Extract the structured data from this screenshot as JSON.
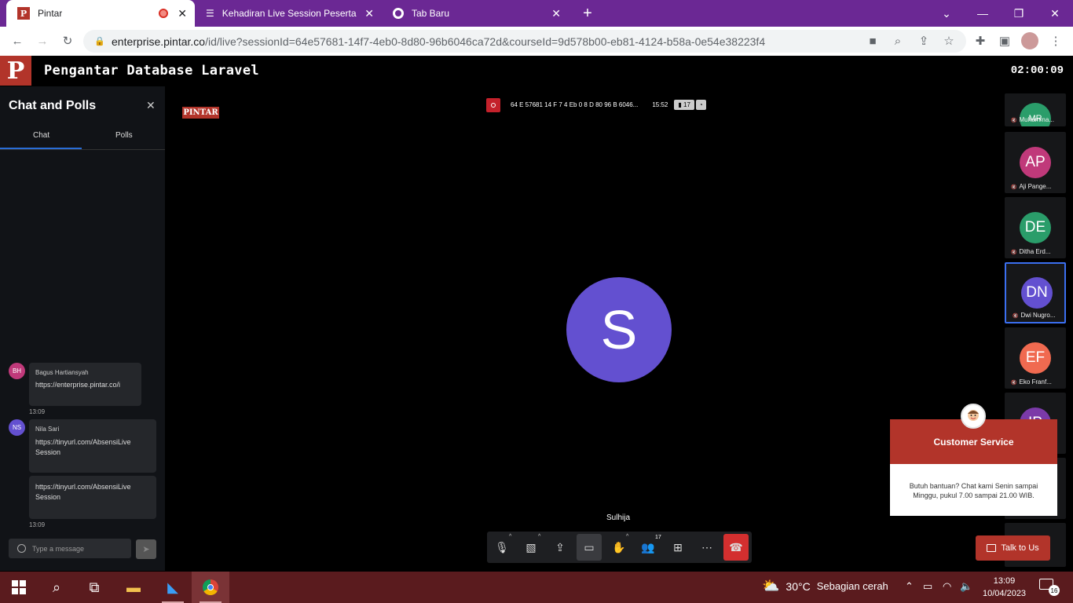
{
  "browser": {
    "tabs": [
      {
        "title": "Pintar",
        "active": true
      },
      {
        "title": "Kehadiran Live Session Peserta D",
        "active": false
      },
      {
        "title": "Tab Baru",
        "active": false
      }
    ],
    "url_domain": "enterprise.pintar.co",
    "url_path": "/id/live?sessionId=64e57681-14f7-4eb0-8d80-96b6046ca72d&courseId=9d578b00-eb81-4124-b58a-0e54e38223f4"
  },
  "header": {
    "logo": "P",
    "course_title": "Pengantar Database Laravel",
    "timer": "02:00:09"
  },
  "chat": {
    "title": "Chat and Polls",
    "tabs": [
      "Chat",
      "Polls"
    ],
    "messages": [
      {
        "initials": "BH",
        "avatar_color": "#c0397a",
        "sender": "Bagus Hartiansyah",
        "text": "https://enterprise.pintar.co/i",
        "time": "13:09"
      },
      {
        "initials": "NS",
        "avatar_color": "#6350d0",
        "sender": "Nila Sari",
        "text": "https://tinyurl.com/AbsensiLive Session",
        "text2": "https://tinyurl.com/AbsensiLive Session",
        "time": "13:09"
      }
    ],
    "input_placeholder": "Type a message"
  },
  "stage": {
    "brand_tag": "PINTAR",
    "session_id": "64 E 57681 14 F 7 4 Eb 0 8 D 80 96 B 6046...",
    "session_time": "15:52",
    "participant_count": "17",
    "main_avatar": {
      "initial": "S",
      "color": "#6350d0"
    },
    "speaker_name": "Sulhija"
  },
  "participants": [
    {
      "initials": "MR",
      "name": "Muhamma...",
      "color": "#2a9d6a"
    },
    {
      "initials": "AP",
      "name": "Aji Pange...",
      "color": "#c0397a"
    },
    {
      "initials": "DE",
      "name": "Ditha Erd...",
      "color": "#2a9d6a"
    },
    {
      "initials": "DN",
      "name": "Dwi Nugro...",
      "color": "#6350d0"
    },
    {
      "initials": "EF",
      "name": "Eko Franf...",
      "color": "#f06a50"
    },
    {
      "initials": "IP",
      "name": "",
      "color": "#7b3aa8"
    }
  ],
  "customer_service": {
    "title": "Customer Service",
    "body": "Butuh bantuan? Chat kami Senin sampai Minggu, pukul 7.00 sampai 21.00 WIB.",
    "button": "Talk to Us"
  },
  "taskbar": {
    "weather_temp": "30°C",
    "weather_text": "Sebagian cerah",
    "time": "13:09",
    "date": "10/04/2023",
    "notification_count": "16"
  }
}
